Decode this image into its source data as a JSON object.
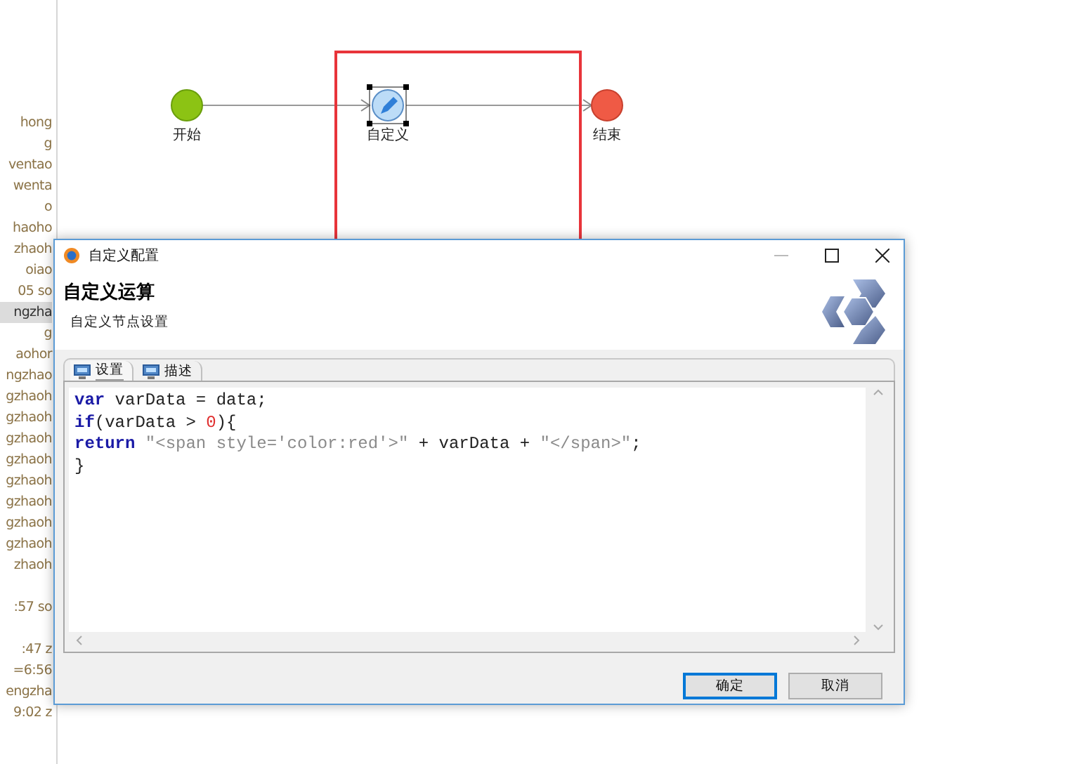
{
  "sidebar": {
    "groups": [
      [
        {
          "text": "hong",
          "selected": false
        },
        {
          "text": "g",
          "selected": false
        },
        {
          "text": "ventao",
          "selected": false
        },
        {
          "text": "wenta",
          "selected": false
        },
        {
          "text": "o",
          "selected": false
        },
        {
          "text": "haoho",
          "selected": false
        },
        {
          "text": "zhaoh",
          "selected": false
        },
        {
          "text": "oiao",
          "selected": false
        },
        {
          "text": "05  so",
          "selected": false
        },
        {
          "text": "ngzha",
          "selected": true
        },
        {
          "text": "g",
          "selected": false
        },
        {
          "text": "aohor",
          "selected": false
        },
        {
          "text": "ngzhao",
          "selected": false
        },
        {
          "text": "gzhaoh",
          "selected": false
        },
        {
          "text": "gzhaoh",
          "selected": false
        },
        {
          "text": "gzhaoh",
          "selected": false
        },
        {
          "text": "gzhaoh",
          "selected": false
        },
        {
          "text": "gzhaoh",
          "selected": false
        },
        {
          "text": "gzhaoh",
          "selected": false
        },
        {
          "text": "gzhaoh",
          "selected": false
        },
        {
          "text": "gzhaoh",
          "selected": false
        },
        {
          "text": "zhaoh",
          "selected": false
        }
      ],
      [
        {
          "text": ":57  so",
          "selected": false
        }
      ],
      [
        {
          "text": ":47  z",
          "selected": false
        },
        {
          "text": "=6:56",
          "selected": false
        },
        {
          "text": "engzha",
          "selected": false
        },
        {
          "text": "9:02  z",
          "selected": false
        }
      ]
    ]
  },
  "diagram": {
    "nodes": [
      {
        "kind": "start",
        "label": "开始",
        "selected": false
      },
      {
        "kind": "task",
        "label": "自定义",
        "selected": true
      },
      {
        "kind": "end",
        "label": "结束",
        "selected": false
      }
    ]
  },
  "dialog": {
    "title": "自定义配置",
    "heading": "自定义运算",
    "subheading": "自定义节点设置",
    "tabs": [
      {
        "label": "设置",
        "selected": true
      },
      {
        "label": "描述",
        "selected": false
      }
    ],
    "code": [
      [
        {
          "kind": "keyword",
          "text": "var"
        },
        {
          "kind": "plain",
          "text": " varData = data;"
        }
      ],
      [
        {
          "kind": "keyword",
          "text": "if"
        },
        {
          "kind": "plain",
          "text": "(varData > "
        },
        {
          "kind": "number",
          "text": "0"
        },
        {
          "kind": "plain",
          "text": "){"
        }
      ],
      [
        {
          "kind": "keyword",
          "text": "return"
        },
        {
          "kind": "string",
          "text": " \"<span style='color:red'>\""
        },
        {
          "kind": "plain",
          "text": " + varData + "
        },
        {
          "kind": "string",
          "text": "\"</span>\""
        },
        {
          "kind": "plain",
          "text": ";"
        }
      ],
      [
        {
          "kind": "plain",
          "text": "}"
        }
      ]
    ],
    "buttons": [
      {
        "label": "确定",
        "kind": "default"
      },
      {
        "label": "取消",
        "kind": "normal"
      }
    ]
  }
}
